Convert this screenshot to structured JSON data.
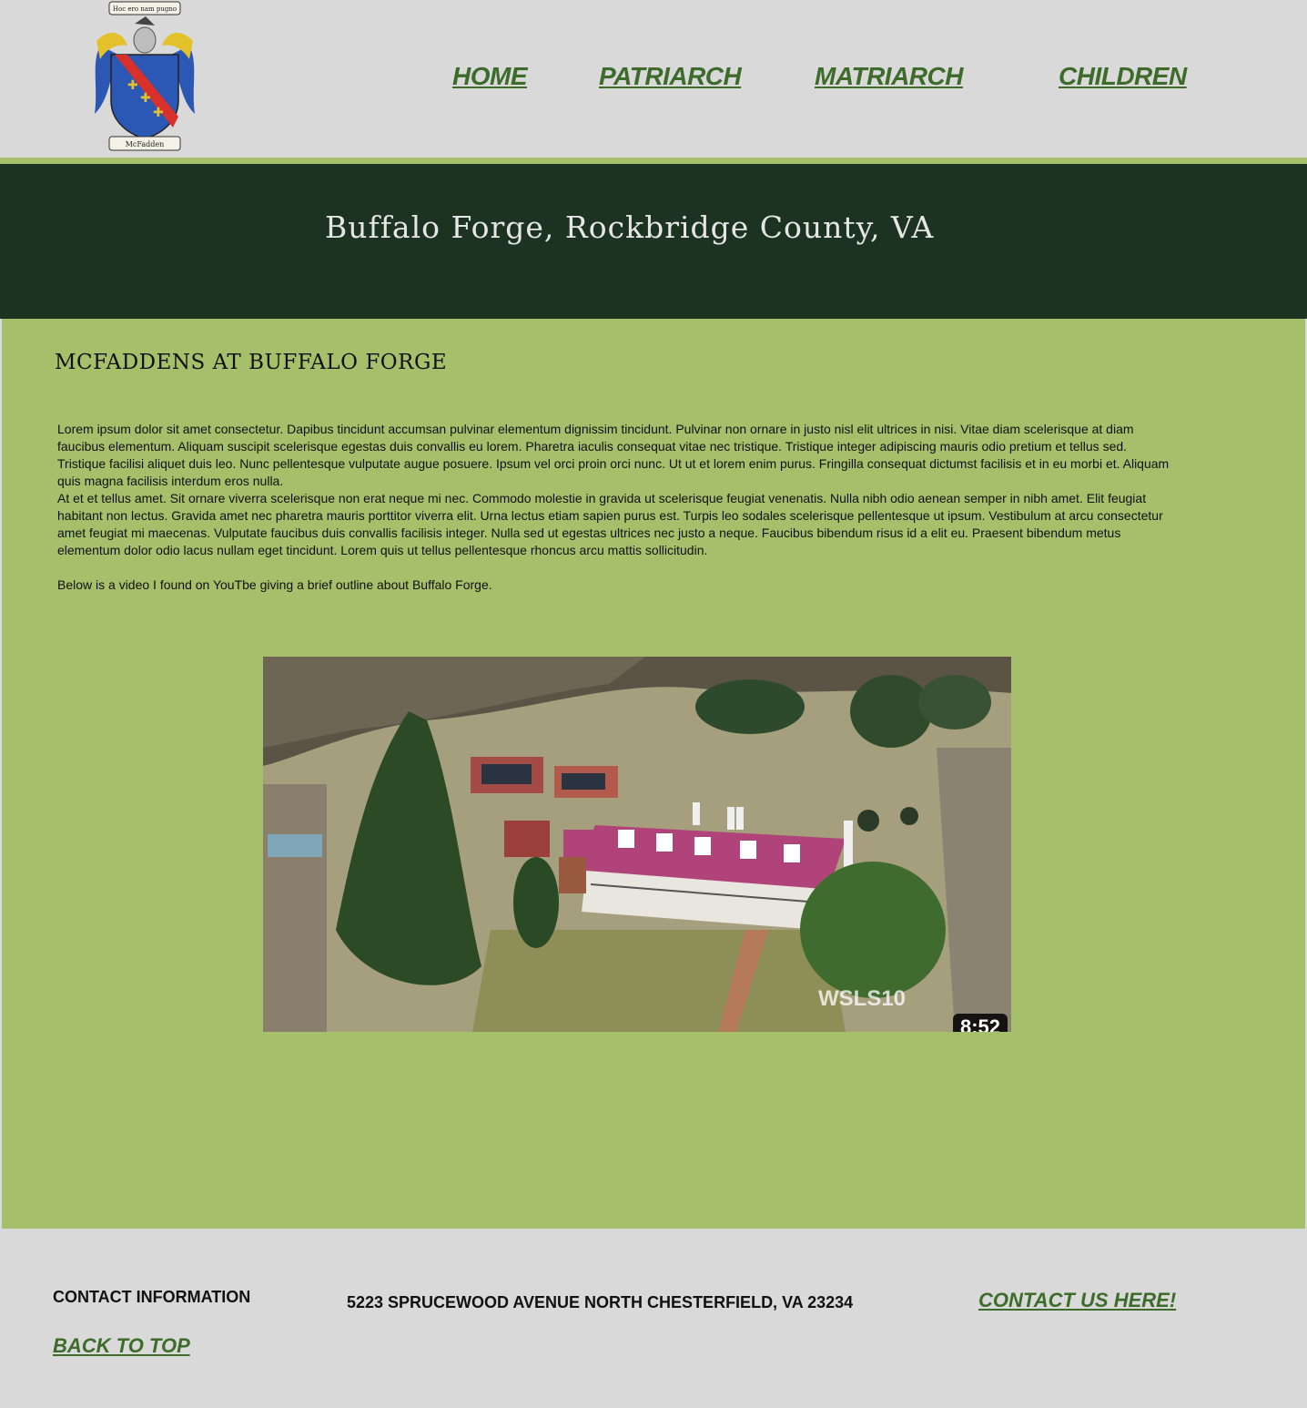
{
  "header": {
    "logo": {
      "motto": "Hoc ero nam pugno",
      "name": "McFadden"
    },
    "nav": [
      {
        "label": "HOME"
      },
      {
        "label": "PATRIARCH"
      },
      {
        "label": "MATRIARCH"
      },
      {
        "label": "CHILDREN"
      }
    ]
  },
  "hero": {
    "title": "Buffalo Forge, Rockbridge County, VA"
  },
  "main": {
    "heading": "MCFADDENS AT BUFFALO FORGE",
    "paragraph1": "Lorem ipsum dolor sit amet consectetur. Dapibus tincidunt accumsan pulvinar elementum dignissim tincidunt. Pulvinar non ornare in justo nisl elit ultrices in nisi. Vitae diam scelerisque at diam faucibus elementum. Aliquam suscipit scelerisque egestas duis convallis eu lorem. Pharetra iaculis consequat vitae nec tristique. Tristique integer adipiscing mauris odio pretium et tellus sed. Tristique facilisi aliquet duis leo. Nunc pellentesque vulputate augue posuere. Ipsum vel orci proin orci nunc. Ut ut et lorem enim purus. Fringilla consequat dictumst facilisis et in eu morbi et. Aliquam quis magna facilisis interdum eros nulla.",
    "paragraph2": "At et et tellus amet. Sit ornare viverra scelerisque non erat neque mi nec. Commodo molestie in gravida ut scelerisque feugiat venenatis. Nulla nibh odio aenean semper in nibh amet. Elit feugiat habitant non lectus. Gravida amet nec pharetra mauris porttitor viverra elit. Urna lectus etiam sapien purus est. Turpis leo sodales scelerisque pellentesque ut ipsum. Vestibulum at arcu consectetur amet feugiat mi maecenas. Vulputate faucibus duis convallis facilisis integer. Nulla sed ut egestas ultrices nec justo a neque. Faucibus bibendum risus id a elit eu. Praesent bibendum metus elementum dolor odio lacus nullam eget tincidunt. Lorem quis ut tellus pellentesque rhoncus arcu mattis sollicitudin.",
    "video_intro": "Below is a video I found on YouTbe  giving a brief outline  about Buffalo Forge.",
    "video": {
      "brand": "WSLS10",
      "duration": "8:52"
    }
  },
  "footer": {
    "contact_heading": "CONTACT INFORMATION",
    "address": "5223 SPRUCEWOOD AVENUE NORTH CHESTERFIELD, VA 23234",
    "contact_link": "CONTACT US HERE!",
    "back_to_top": "BACK TO TOP"
  },
  "colors": {
    "header_bg": "#d9d9d9",
    "hero_bg": "#1b3320",
    "main_bg": "#a5bf6b",
    "link": "#3d6b2a"
  }
}
